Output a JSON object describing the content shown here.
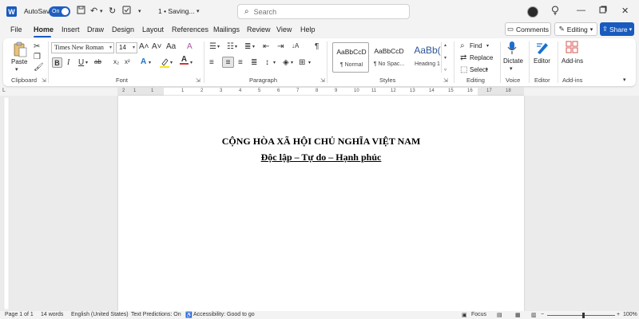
{
  "titlebar": {
    "app_logo": "W",
    "autosave_label": "AutoSave",
    "autosave_state": "On",
    "doc_title": "1 • Saving...",
    "search_placeholder": "Search",
    "icons": [
      "save-icon",
      "undo-icon",
      "redo-icon",
      "chevron-down-icon",
      "lightbulb-icon",
      "minimize-icon",
      "restore-icon",
      "close-icon"
    ]
  },
  "menu": {
    "tabs": [
      "File",
      "Home",
      "Insert",
      "Draw",
      "Design",
      "Layout",
      "References",
      "Mailings",
      "Review",
      "View",
      "Help"
    ],
    "active_tab": "Home",
    "comments_label": "Comments",
    "editing_label": "Editing",
    "share_label": "Share"
  },
  "ribbon": {
    "clipboard": {
      "paste_label": "Paste",
      "group_label": "Clipboard"
    },
    "font": {
      "font_name": "Times New Roman",
      "font_size": "14",
      "group_label": "Font",
      "bold": "B",
      "italic": "I",
      "underline": "U",
      "strike": "ab",
      "subscript": "x₂",
      "superscript": "x²",
      "grow": "A˄",
      "shrink": "A˅",
      "case": "Aa",
      "clear": "A"
    },
    "paragraph": {
      "group_label": "Paragraph",
      "pilcrow": "¶"
    },
    "styles": {
      "group_label": "Styles",
      "items": [
        {
          "sample": "AaBbCcD",
          "name": "¶ Normal"
        },
        {
          "sample": "AaBbCcD",
          "name": "¶ No Spac..."
        },
        {
          "sample": "AaBb(",
          "name": "Heading 1"
        }
      ]
    },
    "editing": {
      "find": "Find",
      "replace": "Replace",
      "select": "Select",
      "group_label": "Editing"
    },
    "voice": {
      "dictate": "Dictate",
      "group_label": "Voice"
    },
    "editor": {
      "label": "Editor",
      "group_label": "Editor"
    },
    "addins": {
      "label": "Add-ins",
      "group_label": "Add-ins"
    }
  },
  "ruler": {
    "numbers": [
      "1",
      "2",
      "1",
      "1",
      "2",
      "3",
      "4",
      "5",
      "6",
      "7",
      "8",
      "9",
      "10",
      "11",
      "12",
      "13",
      "14",
      "15",
      "16",
      "17",
      "18"
    ]
  },
  "document": {
    "line1": "CỘNG HÒA XÃ HỘI CHỦ NGHĨA VIỆT NAM",
    "line2": "Độc lập – Tự do – Hạnh phúc"
  },
  "status": {
    "page": "Page 1 of 1",
    "words": "14 words",
    "language": "English (United States)",
    "predictions": "Text Predictions: On",
    "accessibility": "Accessibility: Good to go",
    "focus": "Focus",
    "zoom": "100%",
    "zoom_level_fraction": 0.53
  }
}
